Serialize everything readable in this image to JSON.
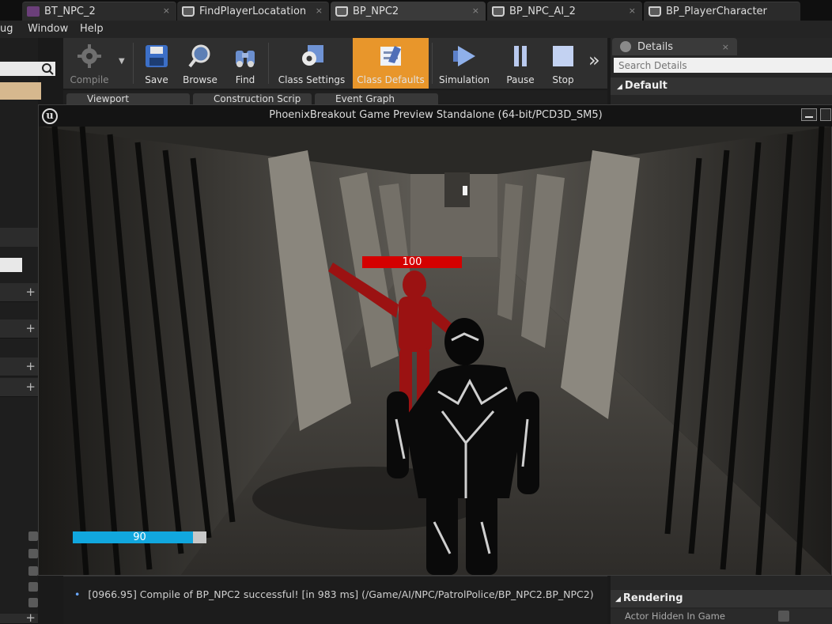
{
  "tabs": [
    {
      "label": "BT_NPC_2",
      "icon": "behavior-tree-icon"
    },
    {
      "label": "FindPlayerLocatation",
      "icon": "blueprint-icon"
    },
    {
      "label": "BP_NPC2",
      "icon": "blueprint-icon",
      "active": true
    },
    {
      "label": "BP_NPC_AI_2",
      "icon": "blueprint-icon"
    },
    {
      "label": "BP_PlayerCharacter",
      "icon": "blueprint-icon"
    }
  ],
  "close_glyph": "×",
  "menu": {
    "debug": "ug",
    "window": "Window",
    "help": "Help"
  },
  "toolbar": {
    "compile": "Compile",
    "save": "Save",
    "browse": "Browse",
    "find": "Find",
    "class_settings": "Class Settings",
    "class_defaults": "Class Defaults",
    "simulation": "Simulation",
    "pause": "Pause",
    "stop": "Stop",
    "more": "»"
  },
  "graph_tabs": {
    "viewport": "Viewport",
    "construction": "Construction Scrip",
    "event_graph": "Event Graph"
  },
  "details": {
    "tab": "Details",
    "search_placeholder": "Search Details",
    "default_section": "Default",
    "rendering_section": "Rendering",
    "actor_hidden": "Actor Hidden In Game"
  },
  "game_window": {
    "title": "PhoenixBreakout Game Preview Standalone (64-bit/PCD3D_SM5)",
    "logo": "u"
  },
  "hud": {
    "enemy_health": 100,
    "player_health": 90,
    "enemy_color": "#d40000",
    "player_color": "#11a7de"
  },
  "log": {
    "bullet": "•",
    "message": "[0966.95] Compile of BP_NPC2 successful! [in 983 ms] (/Game/AI/NPC/PatrolPolice/BP_NPC2.BP_NPC2)"
  },
  "colors": {
    "accent": "#e8962b",
    "panel": "#2f2f2f"
  }
}
